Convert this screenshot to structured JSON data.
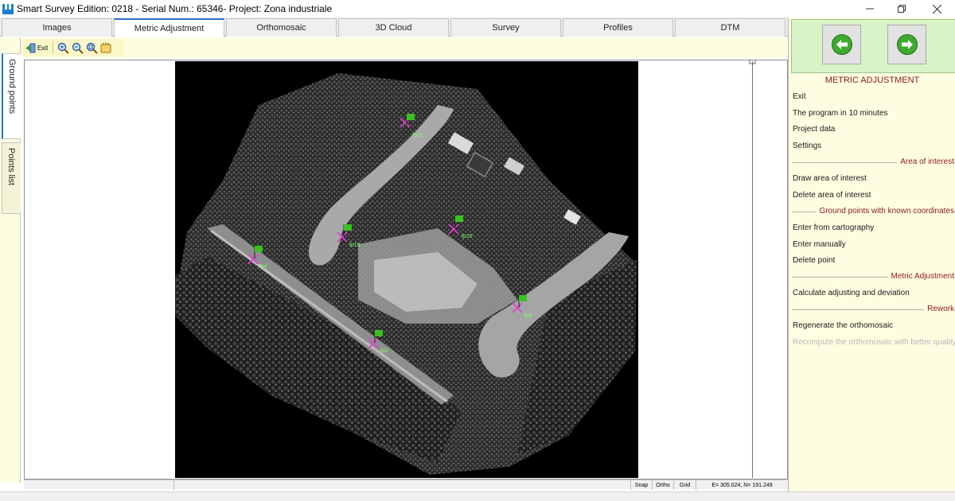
{
  "window": {
    "title": "Smart Survey  Edition: 0218 - Serial Num.: 65346- Project: Zona industriale"
  },
  "tabs": [
    "Images",
    "Metric Adjustment",
    "Orthomosaic",
    "3D Cloud",
    "Survey",
    "Profiles",
    "DTM"
  ],
  "active_tab": "Metric Adjustment",
  "toolbar": {
    "exit_label": "Exit",
    "buttons": [
      "exit-icon",
      "zoom-in-icon",
      "zoom-out-icon",
      "zoom-extent-icon",
      "pan-hand-icon"
    ]
  },
  "side_tabs": {
    "ground_points": "Ground points",
    "points_list": "Points list"
  },
  "points": [
    "fp11",
    "fp19",
    "fp16",
    "fp4",
    "fp8",
    "fp2"
  ],
  "status": {
    "snap": "Snap",
    "ortho": "Ortho",
    "grid": "Grid",
    "coords": "E=  305.024, N=  191.249"
  },
  "panel": {
    "title": "METRIC ADJUSTMENT",
    "menu": {
      "exit": "Exit",
      "program": "The program in 10 minutes",
      "project_data": "Project data",
      "settings": "Settings",
      "draw_area": "Draw area of interest",
      "delete_area": "Delete area of interest",
      "enter_cartography": "Enter from cartography",
      "enter_manually": "Enter manually",
      "delete_point": "Delete point",
      "calculate": "Calculate adjusting and deviation",
      "regenerate": "Regenerate the orthomosaic",
      "recompute": "Recompute the orthomosaic with better quality"
    },
    "sections": {
      "area": "Area of interest",
      "ground": "Ground points with known coordinates",
      "metric": "Metric Adjustment",
      "rework": "Rework"
    }
  },
  "colors": {
    "accent_red": "#8b1a1a",
    "panel_bg": "#fffde1",
    "nav_green": "#3eaa2e",
    "point_cross": "#e040d0",
    "flag_green": "#39c21f"
  }
}
